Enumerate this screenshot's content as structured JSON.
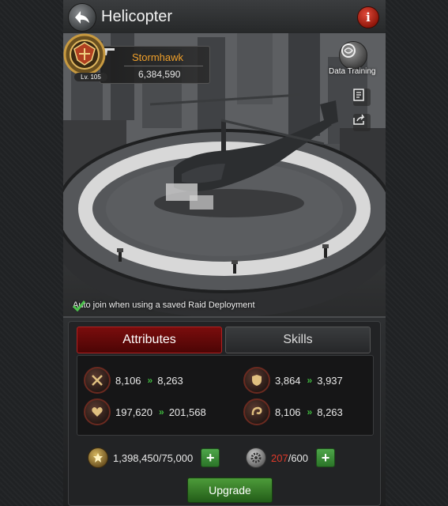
{
  "header": {
    "title": "Helicopter",
    "back_icon": "back-arrow-icon",
    "info_icon": "info-icon",
    "info_glyph": "i"
  },
  "profile": {
    "name": "Stormhawk",
    "level": "Lv. 105",
    "power": "6,384,590"
  },
  "scene": {
    "data_training_label": "Data Training",
    "auto_join_text": "Auto join when using a saved Raid Deployment",
    "auto_join_checked": true
  },
  "tabs": [
    {
      "label": "Attributes",
      "active": true
    },
    {
      "label": "Skills",
      "active": false
    }
  ],
  "attributes": [
    {
      "icon": "attack-swords-icon",
      "current": "8,106",
      "next": "8,263"
    },
    {
      "icon": "defense-shield-icon",
      "current": "3,864",
      "next": "3,937"
    },
    {
      "icon": "health-heart-icon",
      "current": "197,620",
      "next": "201,568"
    },
    {
      "icon": "speed-swirl-icon",
      "current": "8,106",
      "next": "8,263"
    }
  ],
  "resources": {
    "medal": {
      "icon": "medal-icon",
      "value": "1,398,450/75,000"
    },
    "parts": {
      "icon": "gear-icon",
      "current": "207",
      "max": "/600"
    }
  },
  "upgrade_label": "Upgrade",
  "colors": {
    "accent_red": "#7a0d0d",
    "upgrade_green": "#3f8a30",
    "name_orange": "#f0a02a",
    "insufficient_red": "#e03a2a"
  }
}
